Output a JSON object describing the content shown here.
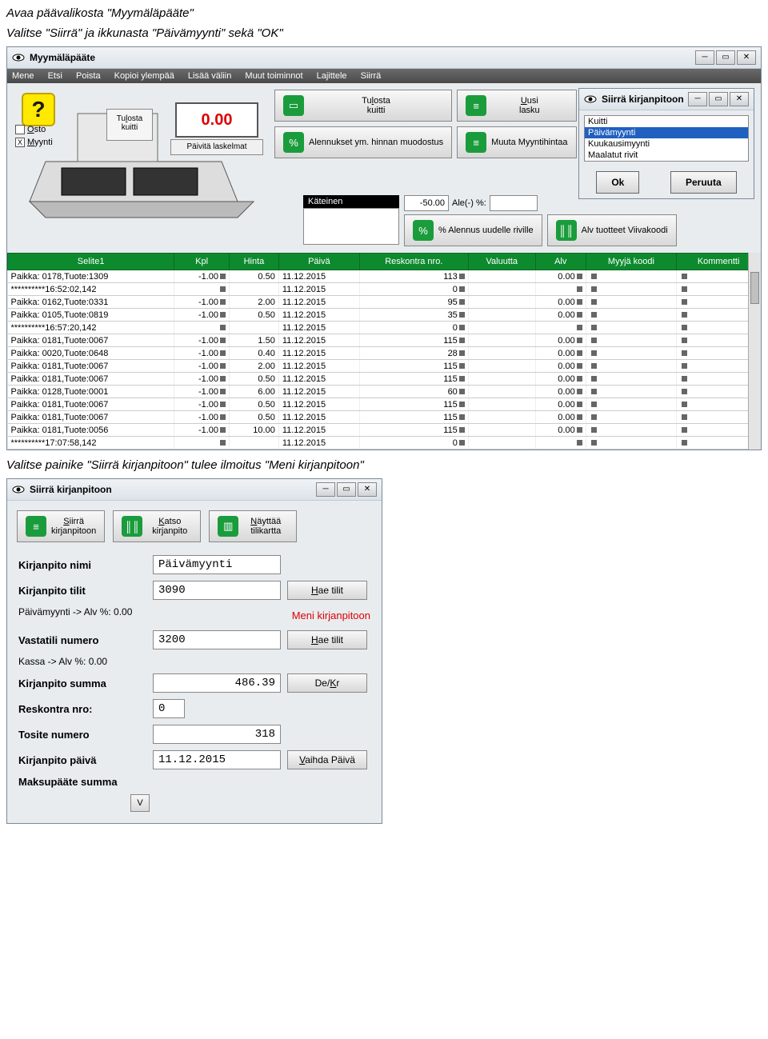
{
  "instr1": "Avaa päävalikosta \"Myymäläpääte\"",
  "instr2": "Valitse \"Siirrä\" ja ikkunasta \"Päivämyynti\" sekä \"OK\"",
  "instr3": "Valitse painike \"Siirrä kirjanpitoon\" tulee ilmoitus \"Meni kirjanpitoon\"",
  "win1": {
    "title": "Myymäläpääte",
    "menu": [
      "Mene",
      "Etsi",
      "Poista",
      "Kopioi ylempää",
      "Lisää väliin",
      "Muut toiminnot",
      "Lajittele",
      "Siirrä"
    ],
    "osto": "Osto",
    "myynti": "Myynti",
    "tulosta_kuitti": "Tulosta kuitti",
    "display": "0.00",
    "paivita": "Päivitä laskelmat",
    "btns": {
      "tulosta2": "Tulosta kuitti",
      "uusi": "Uusi lasku",
      "alennukset": "Alennukset ym. hinnan muodostus",
      "muuta": "Muuta Myyntihintaa",
      "alennus_rivi": "% Alennus uudelle riville",
      "alv": "Alv tuotteet Viivakoodi"
    },
    "kateinen": "Käteinen",
    "neg50": "-50.00",
    "ale": "Ale(-) %:",
    "subwin": {
      "title": "Siirrä kirjanpitoon",
      "items": [
        "Kuitti",
        "Päivämyynti",
        "Kuukausimyynti",
        "Maalatut rivit"
      ],
      "ok": "Ok",
      "peruuta": "Peruuta"
    },
    "headers": [
      "Selite1",
      "Kpl",
      "Hinta",
      "Päivä",
      "Reskontra nro.",
      "Valuutta",
      "Alv",
      "Myyjä koodi",
      "Kommentti"
    ],
    "rows": [
      {
        "s": "Paikka: 0178,Tuote:1309",
        "k": "-1.00",
        "h": "0.50",
        "p": "11.12.2015",
        "r": "113",
        "v": "",
        "a": "0.00",
        "m": "",
        "c": ""
      },
      {
        "s": "**********16:52:02,142",
        "k": "",
        "h": "",
        "p": "11.12.2015",
        "r": "0",
        "v": "",
        "a": "",
        "m": "",
        "c": ""
      },
      {
        "s": "Paikka: 0162,Tuote:0331",
        "k": "-1.00",
        "h": "2.00",
        "p": "11.12.2015",
        "r": "95",
        "v": "",
        "a": "0.00",
        "m": "",
        "c": ""
      },
      {
        "s": "Paikka: 0105,Tuote:0819",
        "k": "-1.00",
        "h": "0.50",
        "p": "11.12.2015",
        "r": "35",
        "v": "",
        "a": "0.00",
        "m": "",
        "c": ""
      },
      {
        "s": "**********16:57:20,142",
        "k": "",
        "h": "",
        "p": "11.12.2015",
        "r": "0",
        "v": "",
        "a": "",
        "m": "",
        "c": ""
      },
      {
        "s": "Paikka: 0181,Tuote:0067",
        "k": "-1.00",
        "h": "1.50",
        "p": "11.12.2015",
        "r": "115",
        "v": "",
        "a": "0.00",
        "m": "",
        "c": ""
      },
      {
        "s": "Paikka: 0020,Tuote:0648",
        "k": "-1.00",
        "h": "0.40",
        "p": "11.12.2015",
        "r": "28",
        "v": "",
        "a": "0.00",
        "m": "",
        "c": ""
      },
      {
        "s": "Paikka: 0181,Tuote:0067",
        "k": "-1.00",
        "h": "2.00",
        "p": "11.12.2015",
        "r": "115",
        "v": "",
        "a": "0.00",
        "m": "",
        "c": ""
      },
      {
        "s": "Paikka: 0181,Tuote:0067",
        "k": "-1.00",
        "h": "0.50",
        "p": "11.12.2015",
        "r": "115",
        "v": "",
        "a": "0.00",
        "m": "",
        "c": ""
      },
      {
        "s": "Paikka: 0128,Tuote:0001",
        "k": "-1.00",
        "h": "6.00",
        "p": "11.12.2015",
        "r": "60",
        "v": "",
        "a": "0.00",
        "m": "",
        "c": ""
      },
      {
        "s": "Paikka: 0181,Tuote:0067",
        "k": "-1.00",
        "h": "0.50",
        "p": "11.12.2015",
        "r": "115",
        "v": "",
        "a": "0.00",
        "m": "",
        "c": ""
      },
      {
        "s": "Paikka: 0181,Tuote:0067",
        "k": "-1.00",
        "h": "0.50",
        "p": "11.12.2015",
        "r": "115",
        "v": "",
        "a": "0.00",
        "m": "",
        "c": ""
      },
      {
        "s": "Paikka: 0181,Tuote:0056",
        "k": "-1.00",
        "h": "10.00",
        "p": "11.12.2015",
        "r": "115",
        "v": "",
        "a": "0.00",
        "m": "",
        "c": ""
      },
      {
        "s": "**********17:07:58,142",
        "k": "",
        "h": "",
        "p": "11.12.2015",
        "r": "0",
        "v": "",
        "a": "",
        "m": "",
        "c": ""
      }
    ]
  },
  "win2": {
    "title": "Siirrä kirjanpitoon",
    "btns": {
      "siirra": "Siirrä kirjanpitoon",
      "katso": "Katso kirjanpito",
      "nayta": "Näyttää tilikartta"
    },
    "labels": {
      "nimi": "Kirjanpito nimi",
      "tilit": "Kirjanpito tilit",
      "alv_note": "Päivämyynti -> Alv %: 0.00",
      "meni": "Meni kirjanpitoon",
      "vastatili": "Vastatili numero",
      "kassa_note": "Kassa -> Alv %: 0.00",
      "summa": "Kirjanpito summa",
      "reskontra": "Reskontra nro:",
      "tosite": "Tosite numero",
      "paiva": "Kirjanpito päivä",
      "maksu": "Maksupääte summa"
    },
    "vals": {
      "nimi": "Päivämyynti",
      "tilit": "3090",
      "vastatili": "3200",
      "summa": "486.39",
      "reskontra": "0",
      "tosite": "318",
      "paiva": "11.12.2015"
    },
    "btnlabels": {
      "hae": "Hae tilit",
      "dekr": "De/Kr",
      "vaihda": "Vaihda Päivä",
      "v": "V"
    }
  }
}
